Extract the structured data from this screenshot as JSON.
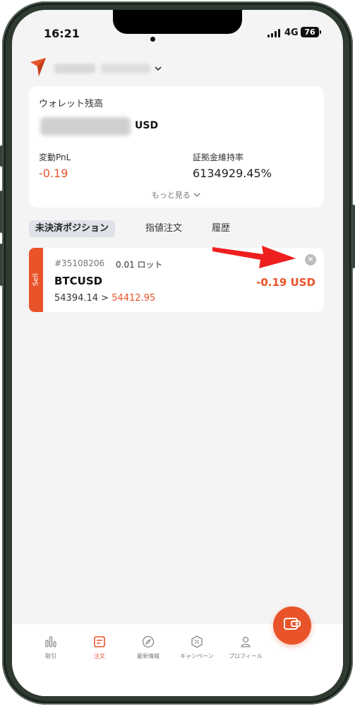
{
  "status_bar": {
    "time": "16:21",
    "network": "4G",
    "battery": "76"
  },
  "colors": {
    "accent": "#e9532a",
    "background": "#f4f4f4"
  },
  "header": {
    "logo_icon": "brand-arrow-icon",
    "account_chevron_icon": "chevron-down-icon"
  },
  "wallet": {
    "label": "ウォレット残高",
    "balance_currency": "USD",
    "pnl_label": "変動PnL",
    "pnl_value": "-0.19",
    "margin_label": "証拠金維持率",
    "margin_value": "6134929.45%",
    "more_label": "もっと見る"
  },
  "tabs": [
    {
      "label": "未決済ポジション",
      "active": true
    },
    {
      "label": "指値注文",
      "active": false
    },
    {
      "label": "履歴",
      "active": false
    }
  ],
  "position": {
    "side": "Sell",
    "order_id": "#35108206",
    "lot": "0.01 ロット",
    "symbol": "BTCUSD",
    "pnl": "-0.19 USD",
    "open_price": "54394.14",
    "separator": ">",
    "current_price": "54412.95"
  },
  "nav": [
    {
      "label": "取引",
      "icon": "bar-chart-icon",
      "active": false
    },
    {
      "label": "注文",
      "icon": "order-note-icon",
      "active": true
    },
    {
      "label": "最新情報",
      "icon": "compass-icon",
      "active": false
    },
    {
      "label": "キャンペーン",
      "icon": "campaign-badge-icon",
      "active": false
    },
    {
      "label": "プロフィール",
      "icon": "person-icon",
      "active": false
    }
  ],
  "fab": {
    "icon": "wallet-transfer-icon"
  }
}
